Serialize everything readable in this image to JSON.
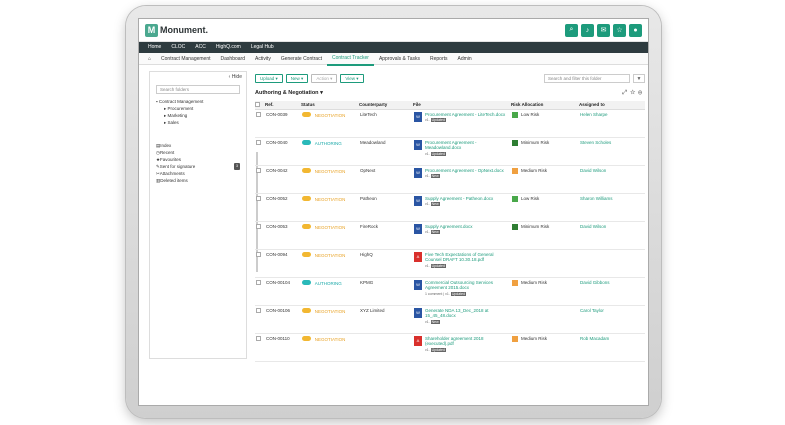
{
  "app": {
    "name": "Monument.",
    "logo_letter": "M"
  },
  "top_icons": [
    "search-icon",
    "bell-icon",
    "mail-icon",
    "star-icon",
    "user-icon"
  ],
  "nav": [
    "Home",
    "CLOC",
    "ACC",
    "HighQ.com",
    "Legal Hub"
  ],
  "menu": [
    "Contract Management",
    "Dashboard",
    "Activity",
    "Generate Contract",
    "Contract Tracker",
    "Approvals & Tasks",
    "Reports",
    "Admin"
  ],
  "sidebar": {
    "hide": "Hide",
    "search_placeholder": "Search folders",
    "root": "Contract Management",
    "folders": [
      "Procurement",
      "Marketing",
      "Sales"
    ],
    "links": [
      "Index",
      "Recent",
      "Favourites",
      "Sent for signature",
      "Attachments",
      "Deleted items"
    ],
    "sent_badge": "3"
  },
  "toolbar": {
    "upload": "Upload",
    "new": "New",
    "action": "Action",
    "view": "View",
    "search_placeholder": "Search and filter this folder"
  },
  "view_title": "Authoring & Negotiation",
  "columns": [
    "Ref.",
    "Status",
    "Counterparty",
    "File",
    "Risk Allocation",
    "Assigned to"
  ],
  "rows": [
    {
      "ref": "CON-0039",
      "status": "NEGOTIATION",
      "cp": "LiteTech",
      "file": "Procurement Agreement - LiteTech.docx",
      "ft": "word",
      "meta": "v1.",
      "tag": "Updated",
      "risk": "Low Risk",
      "rc": "#49a84a",
      "assign": "Helen Sharpe"
    },
    {
      "ref": "CON-0040",
      "status": "AUTHORING",
      "cp": "Meadowland",
      "file": "Procurement Agreement - Meadowland.docx",
      "ft": "word",
      "meta": "v1.",
      "tag": "Updated",
      "risk": "Minimum Risk",
      "rc": "#2e7d32",
      "assign": "Steven Scholes"
    },
    {
      "ref": "CON-0042",
      "status": "NEGOTIATION",
      "cp": "OpNext",
      "file": "Procurement Agreement - OpNext.docx",
      "ft": "word",
      "meta": "v1.",
      "tag": "New",
      "risk": "Medium Risk",
      "rc": "#f0a040",
      "assign": "David Wilson"
    },
    {
      "ref": "CON-0052",
      "status": "NEGOTIATION",
      "cp": "Patheon",
      "file": "Supply Agreement - Patheon.docx",
      "ft": "word",
      "meta": "v1.",
      "tag": "New",
      "risk": "Low Risk",
      "rc": "#49a84a",
      "assign": "Sharon Williams"
    },
    {
      "ref": "CON-0053",
      "status": "NEGOTIATION",
      "cp": "FireRock",
      "file": "Supply Agreement.docx",
      "ft": "word",
      "meta": "v1.",
      "tag": "New",
      "risk": "Minimum Risk",
      "rc": "#2e7d32",
      "assign": "David Wilson"
    },
    {
      "ref": "CON-0094",
      "status": "NEGOTIATION",
      "cp": "HighQ",
      "file": "Five Tech Expectations of General Counsel DRAFT 10.30.18.pdf",
      "ft": "pdf",
      "meta": "v1.",
      "tag": "Updated",
      "risk": "",
      "rc": "",
      "assign": ""
    },
    {
      "ref": "CON-00104",
      "status": "AUTHORING",
      "cp": "KPMG",
      "file": "Commercial Outsourcing Services Agreement 2015.docx",
      "ft": "word",
      "meta": "1 comment | v1.",
      "tag": "Updated",
      "risk": "Medium Risk",
      "rc": "#f0a040",
      "assign": "David Gibbons"
    },
    {
      "ref": "CON-00106",
      "status": "NEGOTIATION",
      "cp": "XYZ Limited",
      "file": "Generate NDA 13_Dec_2018 at 15_45_48.docx",
      "ft": "word",
      "meta": "v1.",
      "tag": "New",
      "risk": "",
      "rc": "",
      "assign": "Carol Taylor"
    },
    {
      "ref": "CON-00110",
      "status": "NEGOTIATION",
      "cp": "",
      "file": "Shareholder agreement 2018 (executed).pdf",
      "ft": "pdf",
      "meta": "v1.",
      "tag": "Updated",
      "risk": "Medium Risk",
      "rc": "#f0a040",
      "assign": "Rob Macadam"
    }
  ]
}
